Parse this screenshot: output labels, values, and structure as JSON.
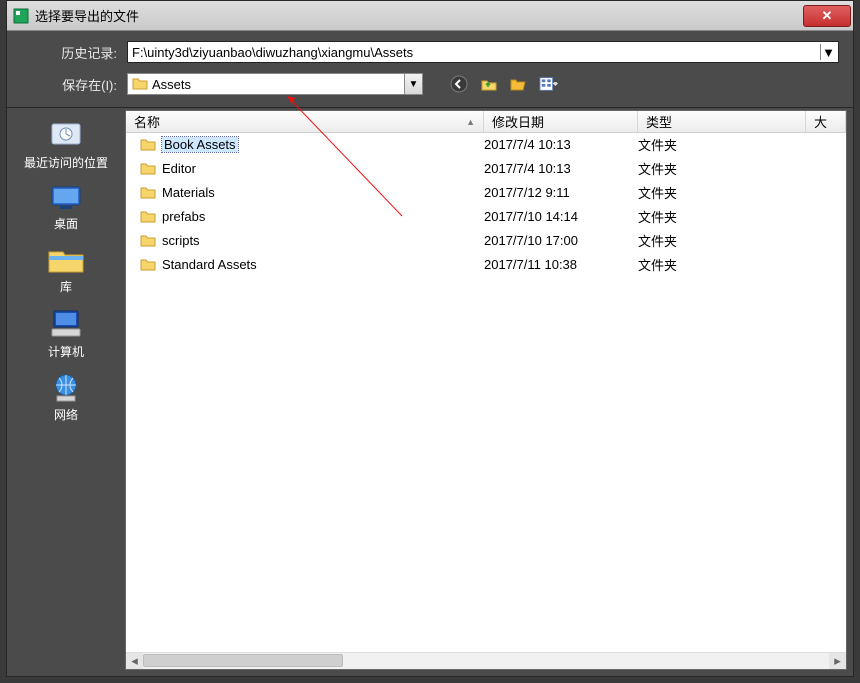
{
  "window": {
    "title": "选择要导出的文件",
    "close_glyph": "✕"
  },
  "history": {
    "label": "历史记录:",
    "value": "F:\\uinty3d\\ziyuanbao\\diwuzhang\\xiangmu\\Assets"
  },
  "save_in": {
    "label": "保存在(I):",
    "value": "Assets"
  },
  "toolbar_icons": {
    "back": "back-arrow-icon",
    "up": "up-folder-icon",
    "newf": "open-folder-icon",
    "view": "view-menu-icon"
  },
  "places": [
    {
      "key": "recent",
      "label": "最近访问的位置"
    },
    {
      "key": "desktop",
      "label": "桌面"
    },
    {
      "key": "library",
      "label": "库"
    },
    {
      "key": "computer",
      "label": "计算机"
    },
    {
      "key": "network",
      "label": "网络"
    }
  ],
  "columns": {
    "name": "名称",
    "date": "修改日期",
    "type": "类型",
    "size": "大"
  },
  "folder_type": "文件夹",
  "files": [
    {
      "name": "Book Assets",
      "date": "2017/7/4 10:13",
      "selected": true
    },
    {
      "name": "Editor",
      "date": "2017/7/4 10:13"
    },
    {
      "name": "Materials",
      "date": "2017/7/12 9:11"
    },
    {
      "name": "prefabs",
      "date": "2017/7/10 14:14"
    },
    {
      "name": "scripts",
      "date": "2017/7/10 17:00"
    },
    {
      "name": "Standard Assets",
      "date": "2017/7/11 10:38"
    }
  ]
}
